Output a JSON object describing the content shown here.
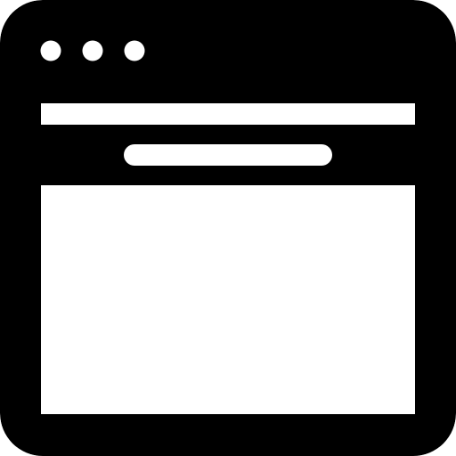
{
  "icon": {
    "name": "browser-window-icon",
    "style": "glyph",
    "colors": {
      "foreground": "#000000",
      "background": "#ffffff"
    },
    "window_control_dots": 3
  }
}
